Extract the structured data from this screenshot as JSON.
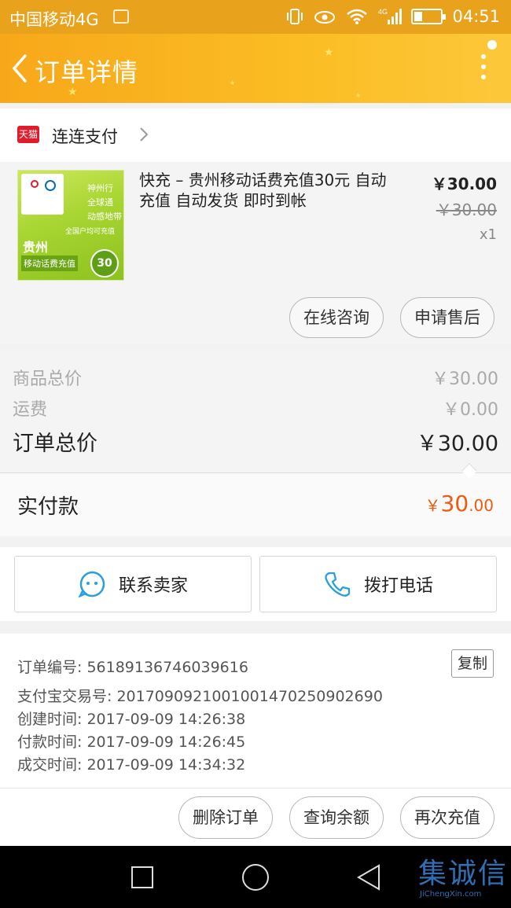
{
  "status_bar": {
    "carrier": "中国移动4G",
    "network": "4G",
    "time": "04:51"
  },
  "header": {
    "title": "订单详情",
    "back_icon": "chevron-left-icon",
    "more_icon": "more-vertical-icon"
  },
  "shop": {
    "logo_text": "天猫",
    "name": "连连支付"
  },
  "product": {
    "title": "快充 – 贵州移动话费充值30元 自动充值 自动发货 即时到帐",
    "price": "￥30.00",
    "original_price": "￥30.00",
    "quantity": "x1",
    "thumb": {
      "line1": "神州行",
      "line2": "全球通",
      "line3": "动感地带",
      "line4": "全国户均可充值",
      "province": "贵州",
      "caption": "移动话费充值",
      "amount": "30"
    },
    "buttons": {
      "consult": "在线咨询",
      "after_sale": "申请售后"
    }
  },
  "summary": {
    "goods_label": "商品总价",
    "goods_value": "￥30.00",
    "shipping_label": "运费",
    "shipping_value": "￥0.00",
    "total_label": "订单总价",
    "total_value": "￥30.00",
    "paid_label": "实付款",
    "paid_currency": "￥",
    "paid_integer": "30",
    "paid_decimal": ".00"
  },
  "contacts": {
    "seller_label": "联系卖家",
    "phone_label": "拨打电话"
  },
  "order_info": {
    "order_no": "订单编号: 56189136746039616",
    "copy_label": "复制",
    "alipay_no": "支付宝交易号: 2017090921001001470250902690",
    "created": "创建时间: 2017-09-09 14:26:38",
    "paid": "付款时间: 2017-09-09 14:26:45",
    "completed": "成交时间: 2017-09-09 14:34:32"
  },
  "actions": {
    "delete": "删除订单",
    "query_balance": "查询余额",
    "recharge_again": "再次充值"
  },
  "watermark": {
    "text": "集诚信",
    "sub": "JiChengXin.com"
  },
  "colors": {
    "header": "#f9b021",
    "status_bar": "#e8a21c",
    "paid_amount": "#f05a0c",
    "icon_blue": "#2a9fd8"
  }
}
